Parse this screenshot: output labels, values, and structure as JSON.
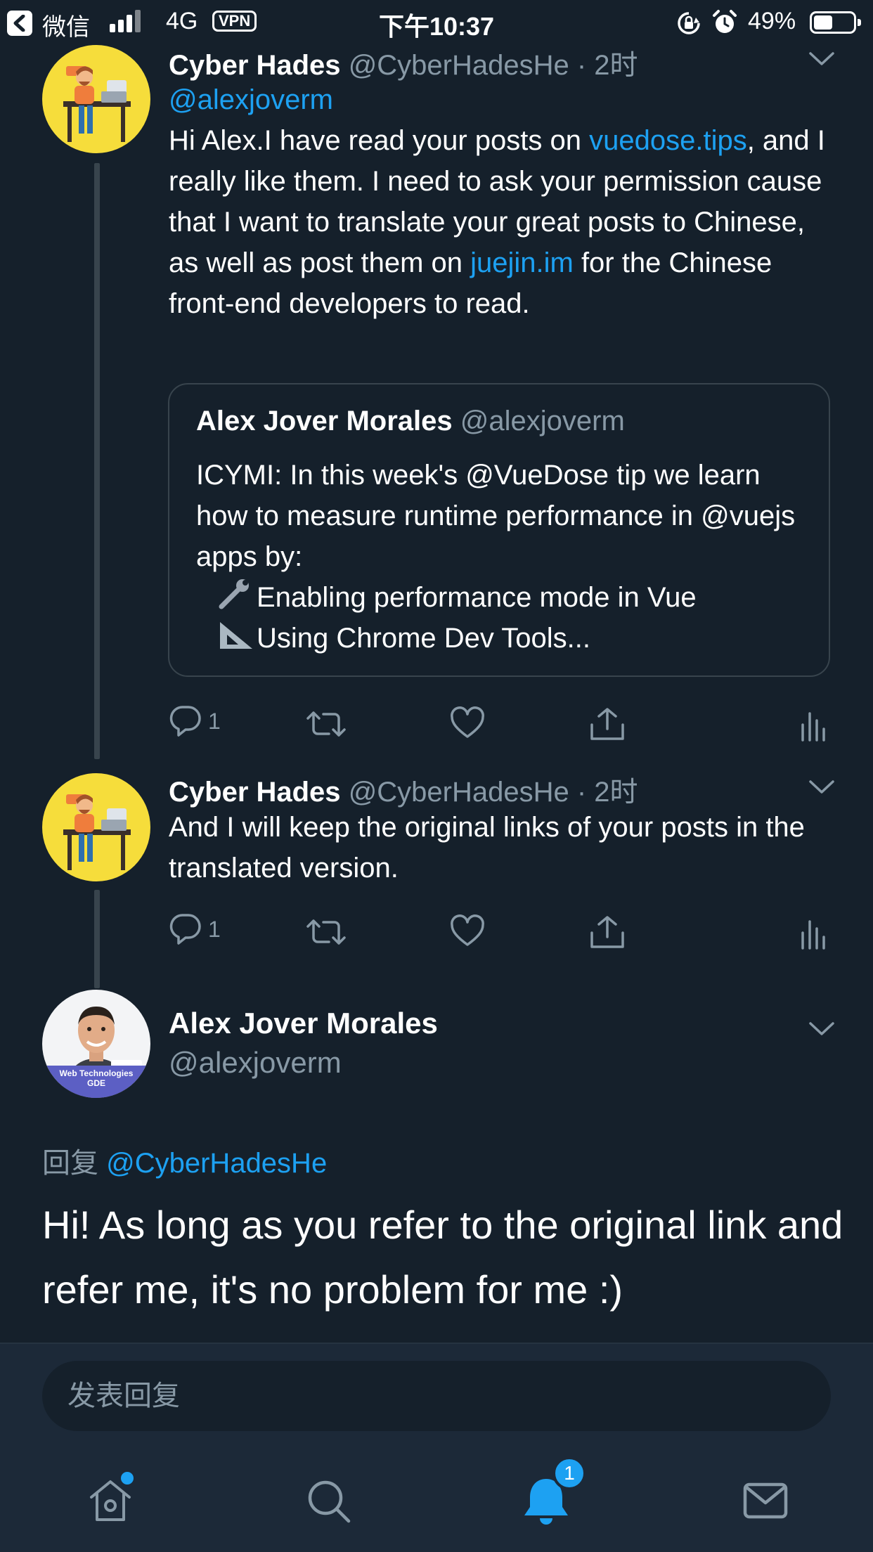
{
  "status_bar": {
    "carrier": "微信",
    "network": "4G",
    "vpn": "VPN",
    "time": "下午10:37",
    "battery_percent": "49%",
    "battery_level": 0.49
  },
  "thread": [
    {
      "name": "Cyber Hades",
      "handle": "@CyberHadesHe",
      "time": "· 2时",
      "reply_mention": "@alexjoverm",
      "text_parts": [
        "Hi Alex.I have read your posts on ",
        "vuedose.tips",
        ", and I really like them. I need to ask your permission cause that I want to translate your great posts to Chinese, as well as post them on ",
        "juejin.im",
        " for the Chinese front-end developers to read."
      ],
      "quote": {
        "name": "Alex Jover Morales",
        "handle": "@alexjoverm",
        "line1": "ICYMI: In this week's @VueDose tip we learn how to measure runtime performance in @vuejs apps by:",
        "line2": "Enabling performance mode in Vue",
        "line3": "Using Chrome Dev Tools..."
      },
      "reply_count": "1"
    },
    {
      "name": "Cyber Hades",
      "handle": "@CyberHadesHe",
      "time": "· 2时",
      "text": "And I will keep the original links of your posts in the translated version.",
      "reply_count": "1"
    }
  ],
  "main_tweet": {
    "name": "Alex Jover Morales",
    "handle": "@alexjoverm",
    "avatar_badge_line1": "Web Technologies",
    "avatar_badge_line2": "GDE",
    "reply_label": "回复",
    "reply_mention": "@CyberHadesHe",
    "text": "Hi! As long as you refer to the original link and refer me, it's no problem for me :)"
  },
  "compose": {
    "placeholder": "发表回复"
  },
  "tabbar": {
    "notifications_badge": "1"
  },
  "colors": {
    "background": "#15202b",
    "accent": "#1da1f2",
    "secondary_text": "#8899a6",
    "border": "#38444d",
    "bar": "#1c2938"
  }
}
